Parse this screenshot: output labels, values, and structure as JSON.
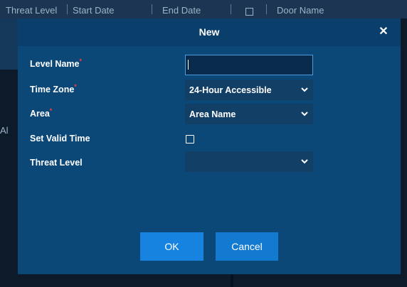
{
  "background_table": {
    "columns": [
      "Threat Level",
      "Start Date",
      "End Date",
      "Door Name"
    ],
    "left_fragment": "Al"
  },
  "dialog": {
    "title": "New",
    "close_symbol": "✕",
    "fields": {
      "level_name": {
        "label": "Level Name",
        "required_mark": "*",
        "value": ""
      },
      "time_zone": {
        "label": "Time Zone",
        "required_mark": "*",
        "selected": "24-Hour Accessible"
      },
      "area": {
        "label": "Area",
        "required_mark": "*",
        "selected": "Area Name"
      },
      "set_valid_time": {
        "label": "Set Valid Time",
        "checked": false
      },
      "threat_level": {
        "label": "Threat Level",
        "selected": ""
      }
    },
    "buttons": {
      "ok": "OK",
      "cancel": "Cancel"
    }
  },
  "colors": {
    "dialog_bg": "#0b4878",
    "header_bg": "#0a3f6b",
    "field_bg": "#123f66",
    "required": "#ff3b3b",
    "button_primary": "#1683e0"
  },
  "icons": [
    "close-icon",
    "chevron-down-icon",
    "checkbox-icon"
  ]
}
